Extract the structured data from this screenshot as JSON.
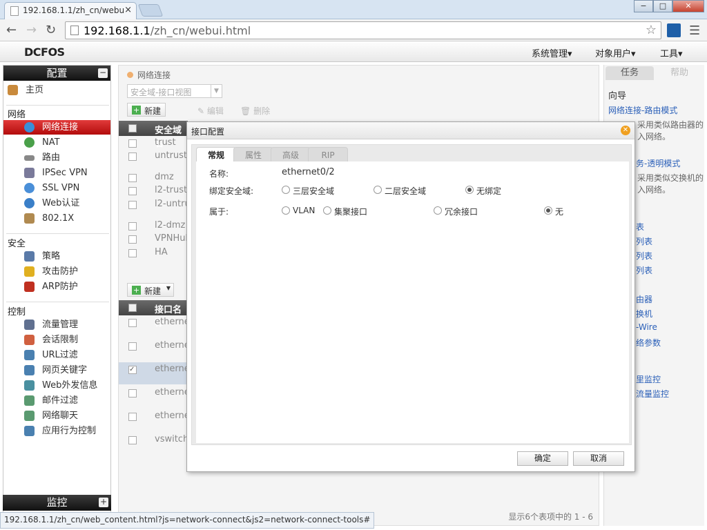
{
  "browser": {
    "tab_title": "192.168.1.1/zh_cn/webu",
    "tab_close": "×",
    "url_host": "192.168.1.1",
    "url_path": "/zh_cn/webui.html",
    "back_icon": "arrow-left",
    "forward_icon": "arrow-right",
    "reload_icon": "reload",
    "star_icon": "star",
    "min": "−",
    "max": "□",
    "close": "✕"
  },
  "app": {
    "logo": "DCFOS",
    "top_menu": [
      "系统管理▾",
      "对象用户▾",
      "工具▾"
    ]
  },
  "sidebar": {
    "header": "配置",
    "header_toggle": "−",
    "home": "主页",
    "sections": {
      "network": "网络",
      "security": "安全",
      "control": "控制"
    },
    "network_items": [
      "网络连接",
      "NAT",
      "路由",
      "IPSec VPN",
      "SSL VPN",
      "Web认证",
      "802.1X"
    ],
    "security_items": [
      "策略",
      "攻击防护",
      "ARP防护"
    ],
    "control_items": [
      "流量管理",
      "会话限制",
      "URL过滤",
      "网页关键字",
      "Web外发信息",
      "邮件过滤",
      "网络聊天",
      "应用行为控制"
    ],
    "monitor": "监控",
    "monitor_toggle": "+"
  },
  "main": {
    "breadcrumb": "网络连接",
    "zone_select": "安全域-接口视图",
    "toolbar": {
      "new": "新建",
      "edit": "编辑",
      "delete": "删除"
    },
    "zone_table": {
      "header": "安全域名",
      "rows": [
        "trust",
        "untrust",
        "dmz",
        "l2-trust",
        "l2-untru",
        "l2-dmz",
        "VPNHub",
        "HA"
      ]
    },
    "if_new": "新建",
    "if_table": {
      "header": "接口名称",
      "rows": [
        "etherne",
        "etherne",
        "etherne",
        "etherne",
        "etherne",
        "vswitch"
      ]
    },
    "pager_text": "显示6个表项中的 1 - 6"
  },
  "right_panel": {
    "tabs": [
      "任务",
      "帮助"
    ],
    "guide_title": "向导",
    "links": [
      "网络连接-路由模式",
      "务-透明模式",
      "表",
      "列表",
      "列表",
      "列表",
      "由器",
      "换机",
      "-Wire",
      "络参数",
      "里监控",
      "流量监控"
    ],
    "texts": [
      "采用类似路由器的",
      "入网络。",
      "采用类似交换机的",
      "入网络。"
    ]
  },
  "modal": {
    "title": "接口配置",
    "close": "✕",
    "tabs": [
      "常规",
      "属性",
      "高级",
      "RIP"
    ],
    "name_label": "名称:",
    "name_value": "ethernet0/2",
    "zone_label": "绑定安全域:",
    "zone_options": [
      "三层安全域",
      "二层安全域",
      "无绑定"
    ],
    "zone_selected": "无绑定",
    "belong_label": "属于:",
    "belong_options": [
      "VLAN",
      "集聚接口",
      "冗余接口",
      "无"
    ],
    "belong_selected": "无",
    "ok": "确定",
    "cancel": "取消"
  },
  "statusbar": "192.168.1.1/zh_cn/web_content.html?js=network-connect&js2=network-connect-tools#"
}
